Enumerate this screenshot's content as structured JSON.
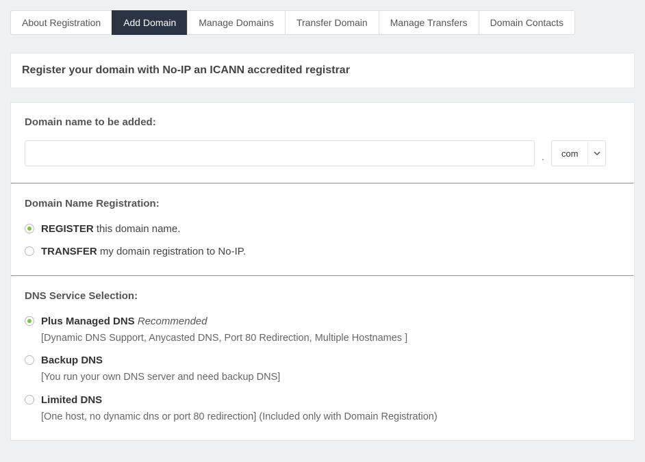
{
  "tabs": {
    "items": [
      {
        "label": "About Registration"
      },
      {
        "label": "Add Domain"
      },
      {
        "label": "Manage Domains"
      },
      {
        "label": "Transfer Domain"
      },
      {
        "label": "Manage Transfers"
      },
      {
        "label": "Domain Contacts"
      }
    ],
    "active_index": 1
  },
  "header": {
    "title": "Register your domain with No-IP an ICANN accredited registrar"
  },
  "domain_section": {
    "label": "Domain name to be added:",
    "input_value": "",
    "dot": ".",
    "tld_selected": "com"
  },
  "registration_section": {
    "label": "Domain Name Registration:",
    "options": [
      {
        "bold": "REGISTER",
        "rest": " this domain name.",
        "checked": true
      },
      {
        "bold": "TRANSFER",
        "rest": " my domain registration to No-IP.",
        "checked": false
      }
    ]
  },
  "dns_section": {
    "label": "DNS Service Selection:",
    "options": [
      {
        "bold": "Plus Managed DNS",
        "suffix_italic": " Recommended",
        "desc": "[Dynamic DNS Support, Anycasted DNS, Port 80 Redirection, Multiple Hostnames ]",
        "checked": true
      },
      {
        "bold": "Backup DNS",
        "suffix_italic": "",
        "desc": "[You run your own DNS server and need backup DNS]",
        "checked": false
      },
      {
        "bold": "Limited DNS",
        "suffix_italic": "",
        "desc": "[One host, no dynamic dns or port 80 redirection] (Included only with Domain Registration)",
        "checked": false
      }
    ]
  }
}
